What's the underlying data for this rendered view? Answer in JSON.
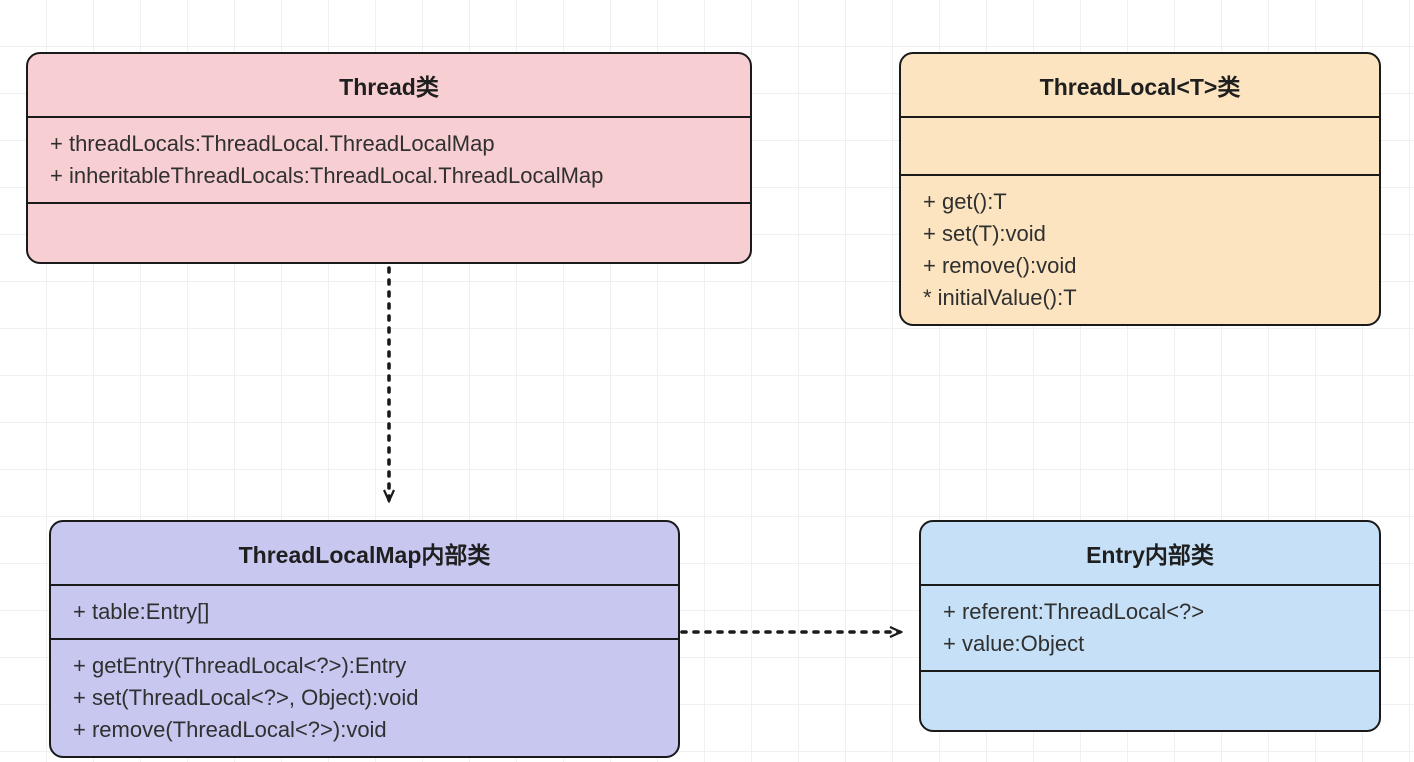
{
  "classes": {
    "thread": {
      "title": "Thread类",
      "attrs": [
        "+ threadLocals:ThreadLocal.ThreadLocalMap",
        "+ inheritableThreadLocals:ThreadLocal.ThreadLocalMap"
      ],
      "methods": []
    },
    "threadlocal": {
      "title": "ThreadLocal<T>类",
      "attrs": [],
      "methods": [
        "+ get():T",
        "+ set(T):void",
        "+ remove():void",
        "* initialValue():T"
      ]
    },
    "threadlocalmap": {
      "title": "ThreadLocalMap内部类",
      "attrs": [
        "+ table:Entry[]"
      ],
      "methods": [
        "+ getEntry(ThreadLocal<?>):Entry",
        "+ set(ThreadLocal<?>, Object):void",
        "+ remove(ThreadLocal<?>):void"
      ]
    },
    "entry": {
      "title": "Entry内部类",
      "attrs": [
        "+ referent:ThreadLocal<?>",
        "+ value:Object"
      ],
      "methods": []
    }
  }
}
